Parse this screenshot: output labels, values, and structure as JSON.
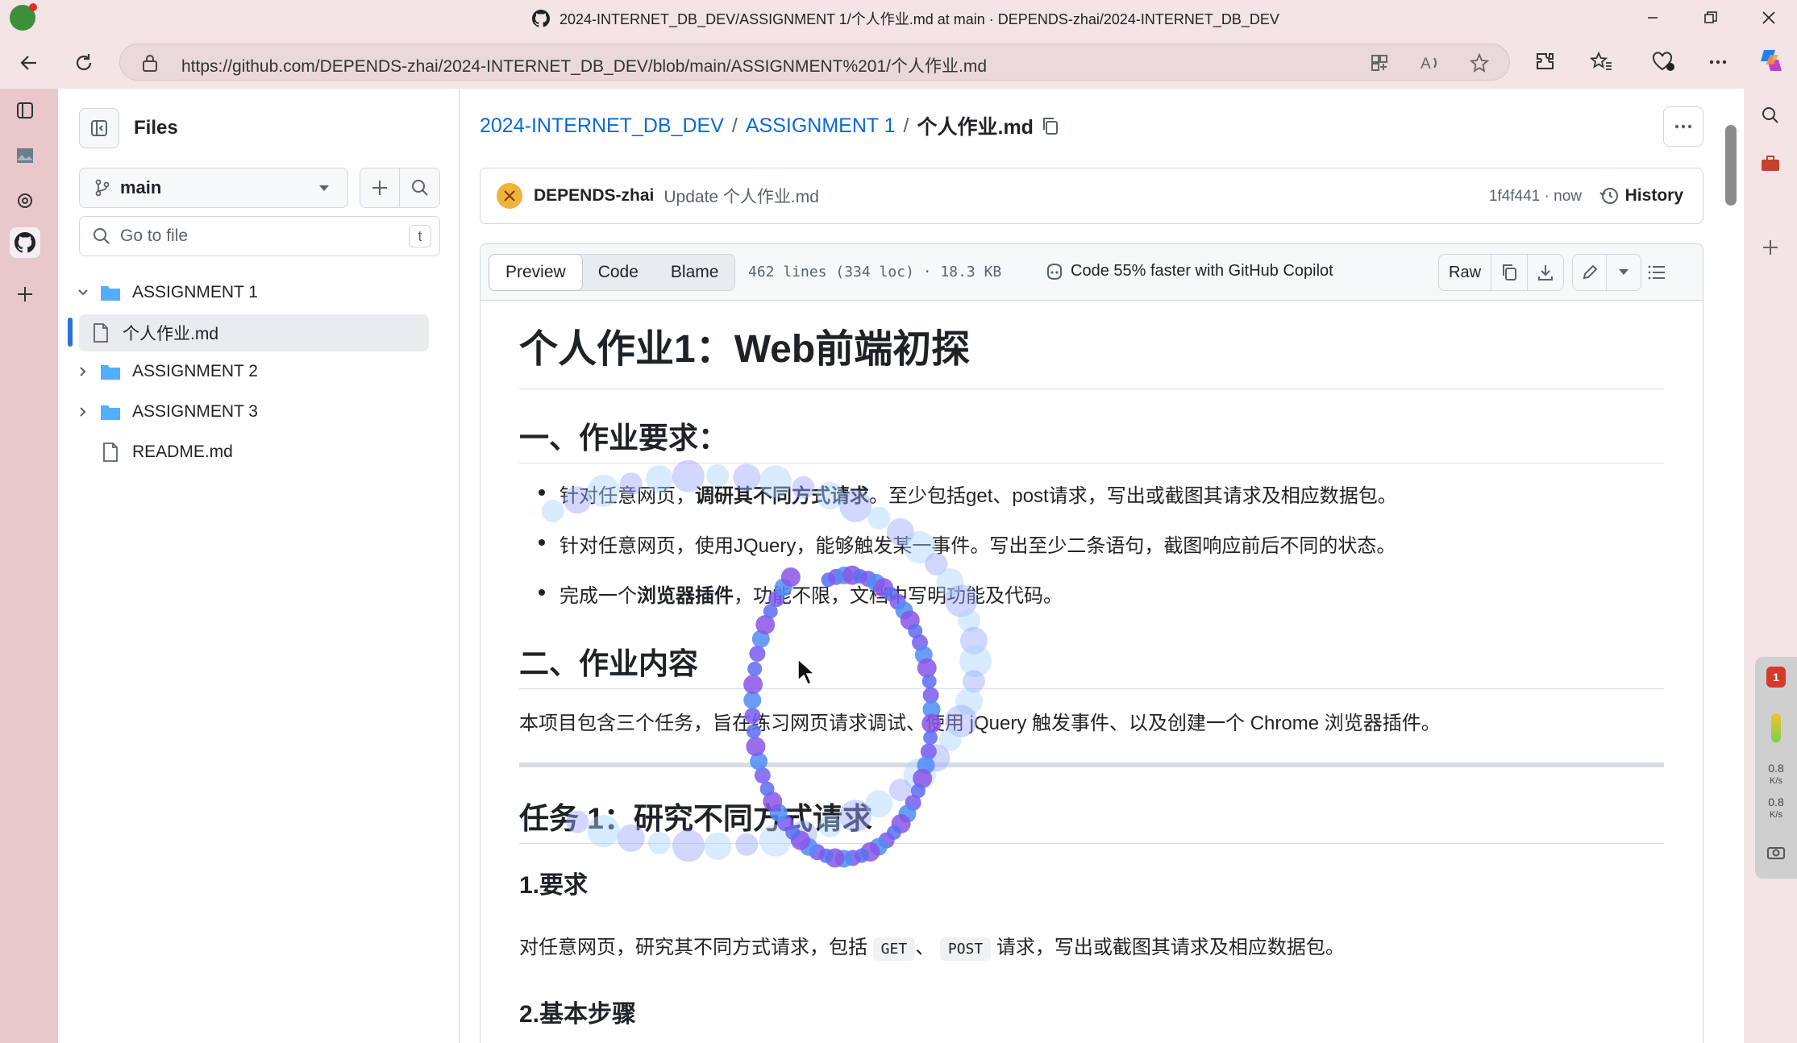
{
  "browser": {
    "window_title": "2024-INTERNET_DB_DEV/ASSIGNMENT 1/个人作业.md at main · DEPENDS-zhai/2024-INTERNET_DB_DEV",
    "url": "https://github.com/DEPENDS-zhai/2024-INTERNET_DB_DEV/blob/main/ASSIGNMENT%201/个人作业.md",
    "netspeed_up": "0.8",
    "netspeed_down": "0.8",
    "netspeed_unit": "K/s",
    "notif_count": "1"
  },
  "sidebar": {
    "title": "Files",
    "branch": "main",
    "goto_placeholder": "Go to file",
    "goto_shortcut": "t",
    "tree": [
      {
        "label": "ASSIGNMENT 1",
        "type": "folder",
        "expanded": true
      },
      {
        "label": "个人作业.md",
        "type": "file",
        "selected": true
      },
      {
        "label": "ASSIGNMENT 2",
        "type": "folder",
        "expanded": false
      },
      {
        "label": "ASSIGNMENT 3",
        "type": "folder",
        "expanded": false
      },
      {
        "label": "README.md",
        "type": "file"
      }
    ]
  },
  "breadcrumb": {
    "repo": "2024-INTERNET_DB_DEV",
    "folder": "ASSIGNMENT 1",
    "file": "个人作业.md",
    "sep": "/"
  },
  "commit": {
    "author": "DEPENDS-zhai",
    "message": "Update 个人作业.md",
    "sha_time": "1f4f441 · now",
    "history_label": "History"
  },
  "file_header": {
    "tabs": [
      "Preview",
      "Code",
      "Blame"
    ],
    "active_tab": "Preview",
    "info": "462 lines (334 loc) · 18.3 KB",
    "copilot": "Code 55% faster with GitHub Copilot",
    "raw_label": "Raw"
  },
  "markdown": {
    "h1": "个人作业1：Web前端初探",
    "h2_requirements": "一、作业要求：",
    "bullet1_a": "针对任意网页，",
    "bullet1_b": "调研其不同方式请求",
    "bullet1_c": "。至少包括get、post请求，写出或截图其请求及相应数据包。",
    "bullet2": "针对任意网页，使用JQuery，能够触发某一事件。写出至少二条语句，截图响应前后不同的状态。",
    "bullet3_a": "完成一个",
    "bullet3_b": "浏览器插件",
    "bullet3_c": "，功能不限，文档中写明功能及代码。",
    "h2_content": "二、作业内容",
    "intro": "本项目包含三个任务，旨在练习网页请求调试、使用 jQuery 触发事件、以及创建一个 Chrome 浏览器插件。",
    "h2_task1": "任务 1：研究不同方式请求",
    "h3_req": "1.要求",
    "req_a": "对任意网页，研究其不同方式请求，包括 ",
    "req_code1": "GET",
    "req_b": "、 ",
    "req_code2": "POST",
    "req_c": " 请求，写出或截图其请求及相应数据包。",
    "h3_steps": "2.基本步骤"
  }
}
